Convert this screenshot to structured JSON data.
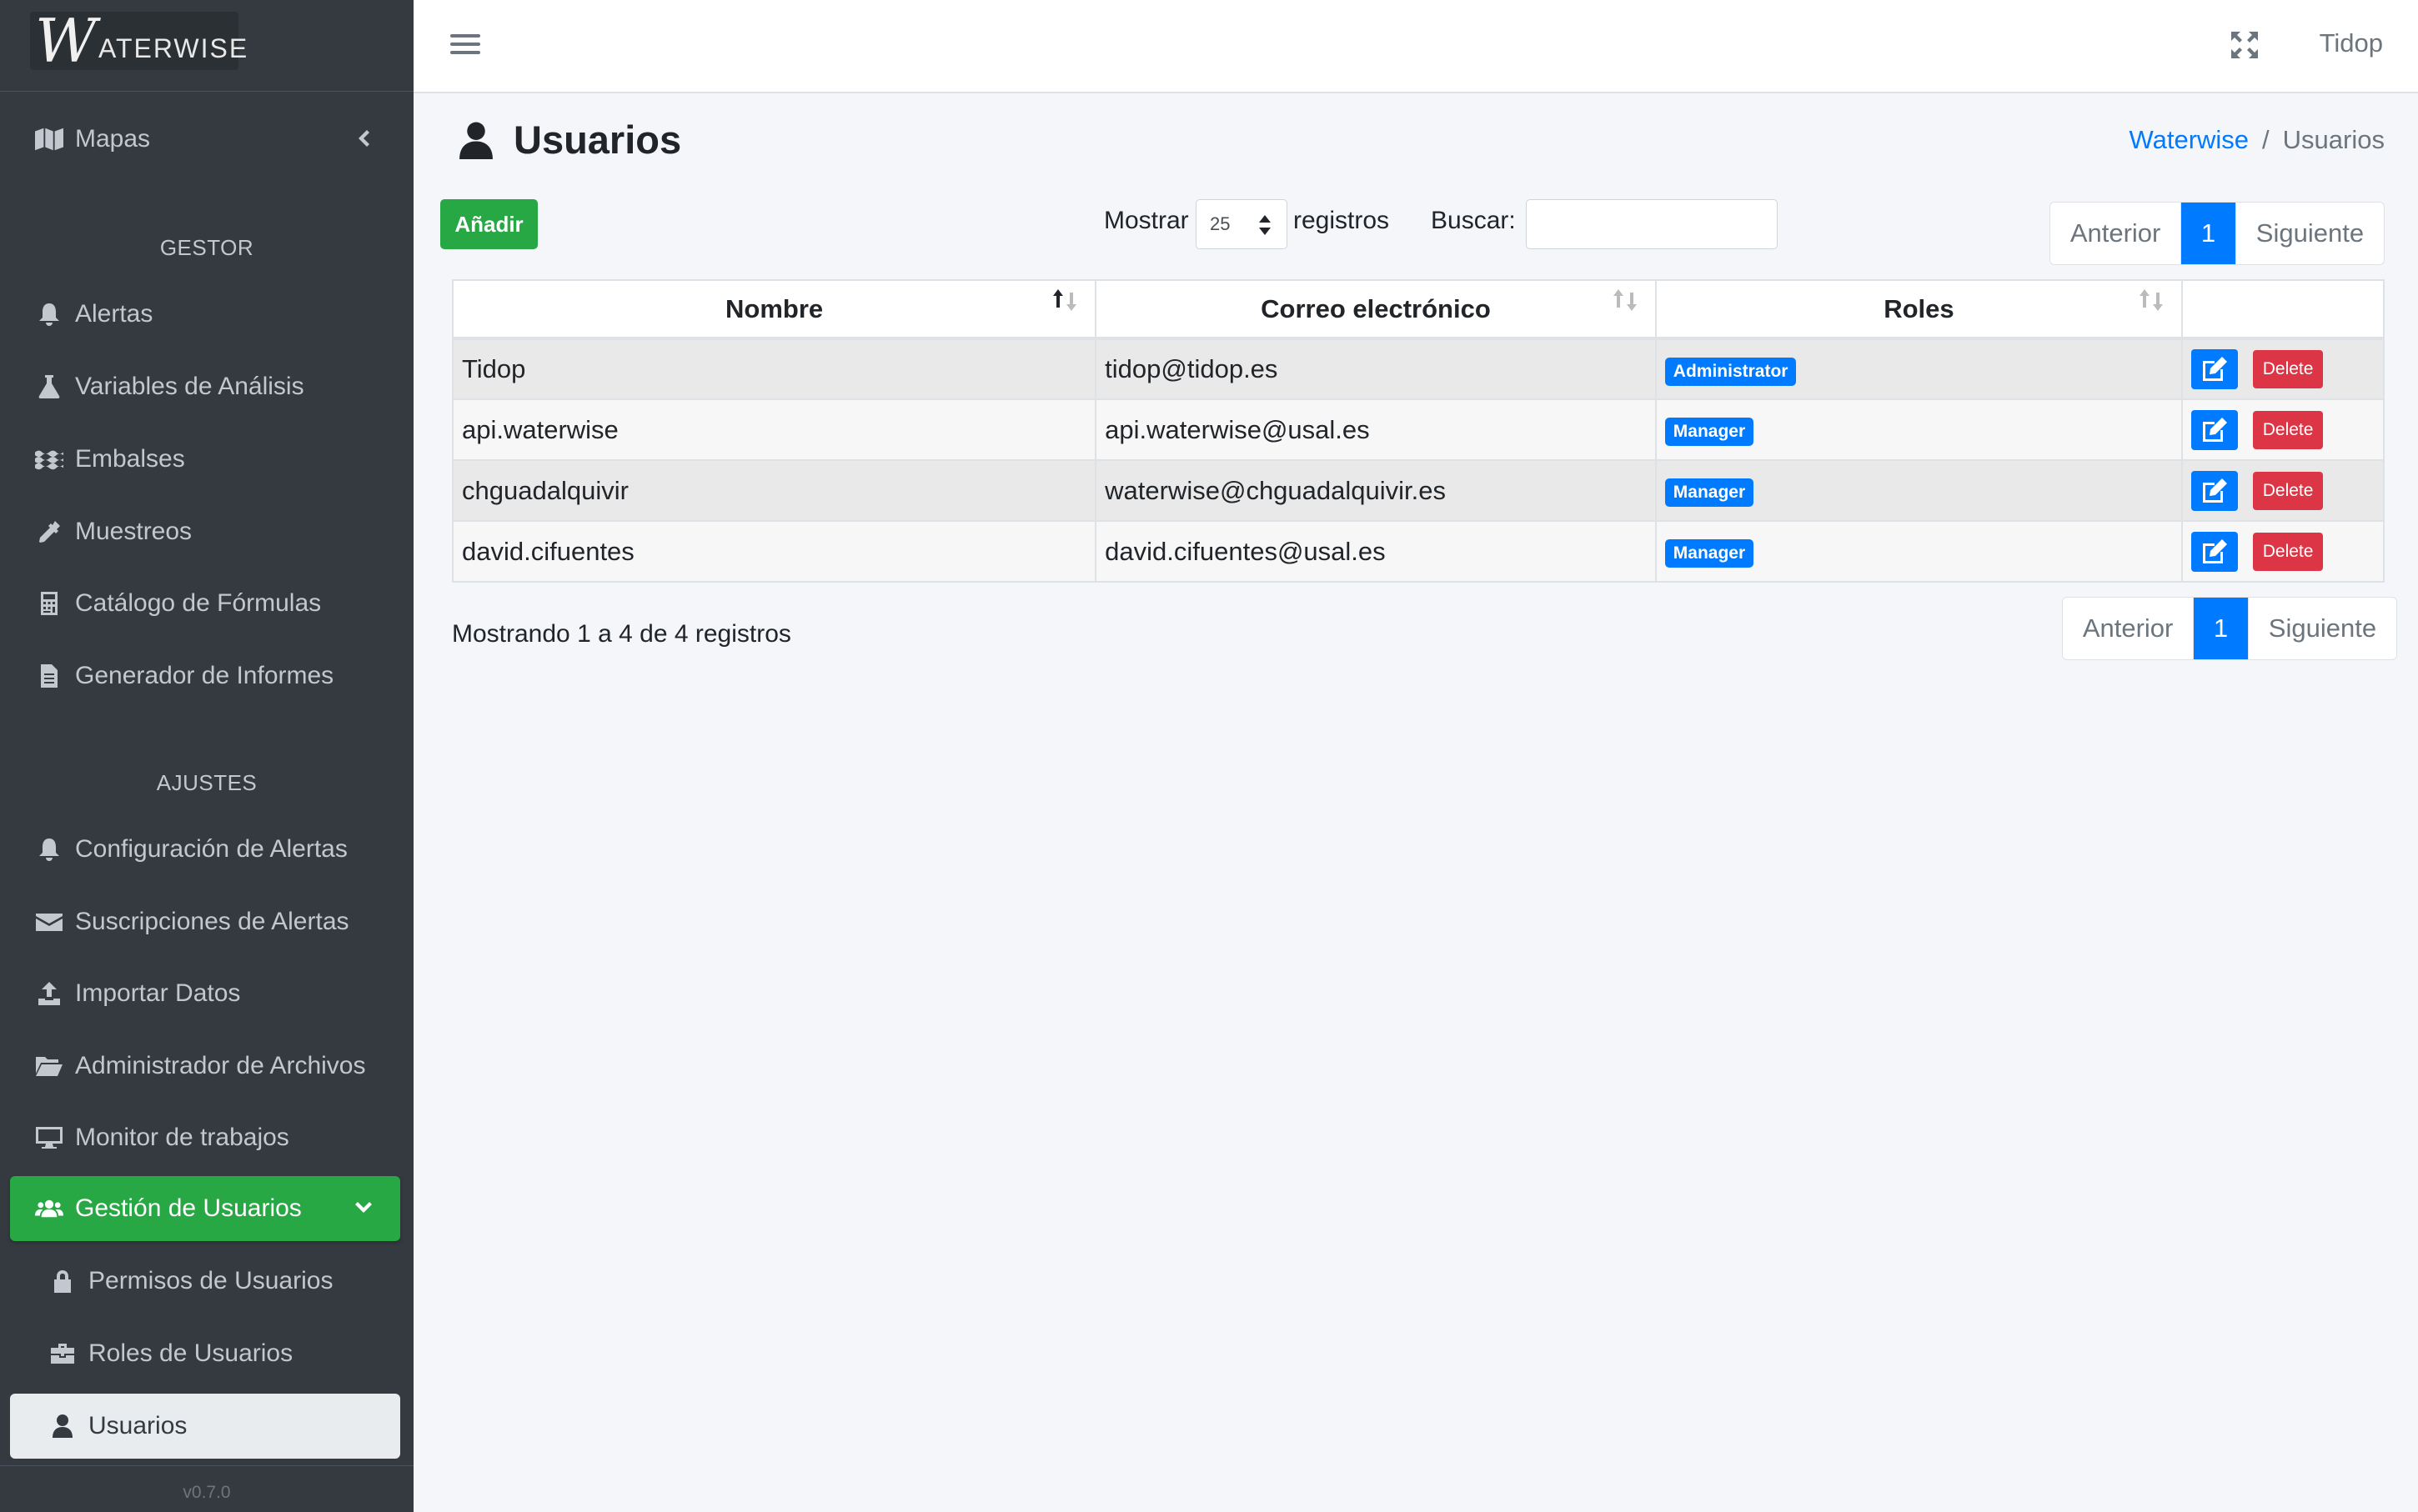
{
  "brand": {
    "logo_mark": "W",
    "logo_text": "ATERWISE"
  },
  "sidebar": {
    "mapas": "Mapas",
    "sections": {
      "gestor": "GESTOR",
      "ajustes": "AJUSTES"
    },
    "gestor_items": [
      {
        "label": "Alertas",
        "icon": "bell-icon"
      },
      {
        "label": "Variables de Análisis",
        "icon": "flask-icon"
      },
      {
        "label": "Embalses",
        "icon": "water-icon"
      },
      {
        "label": "Muestreos",
        "icon": "eyedropper-icon"
      },
      {
        "label": "Catálogo de Fórmulas",
        "icon": "calculator-icon"
      },
      {
        "label": "Generador de Informes",
        "icon": "file-alt-icon"
      }
    ],
    "ajustes_items": [
      {
        "label": "Configuración de Alertas",
        "icon": "bell-icon"
      },
      {
        "label": "Suscripciones de Alertas",
        "icon": "envelope-icon"
      },
      {
        "label": "Importar Datos",
        "icon": "upload-icon"
      },
      {
        "label": "Administrador de Archivos",
        "icon": "folder-open-icon"
      },
      {
        "label": "Monitor de trabajos",
        "icon": "desktop-icon"
      }
    ],
    "user_mgmt": {
      "label": "Gestión de Usuarios",
      "children": [
        {
          "label": "Permisos de Usuarios",
          "icon": "lock-icon"
        },
        {
          "label": "Roles de Usuarios",
          "icon": "briefcase-icon"
        },
        {
          "label": "Usuarios",
          "icon": "user-icon"
        }
      ]
    },
    "version": "v0.7.0"
  },
  "topbar": {
    "user": "Tidop"
  },
  "page": {
    "title": "Usuarios",
    "breadcrumb": {
      "home": "Waterwise",
      "separator": "/",
      "current": "Usuarios"
    }
  },
  "controls": {
    "add_label": "Añadir",
    "show_label": "Mostrar",
    "page_length": "25",
    "records_label": "registros",
    "search_label": "Buscar:",
    "search_value": ""
  },
  "pagination": {
    "prev": "Anterior",
    "current": "1",
    "next": "Siguiente"
  },
  "table": {
    "columns": [
      "Nombre",
      "Correo electrónico",
      "Roles",
      ""
    ],
    "rows": [
      {
        "name": "Tidop",
        "email": "tidop@tidop.es",
        "role": "Administrator",
        "delete": "Delete"
      },
      {
        "name": "api.waterwise",
        "email": "api.waterwise@usal.es",
        "role": "Manager",
        "delete": "Delete"
      },
      {
        "name": "chguadalquivir",
        "email": "waterwise@chguadalquivir.es",
        "role": "Manager",
        "delete": "Delete"
      },
      {
        "name": "david.cifuentes",
        "email": "david.cifuentes@usal.es",
        "role": "Manager",
        "delete": "Delete"
      }
    ],
    "info": "Mostrando 1 a 4 de 4 registros"
  },
  "colors": {
    "primary": "#007bff",
    "success": "#28a745",
    "danger": "#dc3545",
    "sidebar": "#343a40"
  }
}
